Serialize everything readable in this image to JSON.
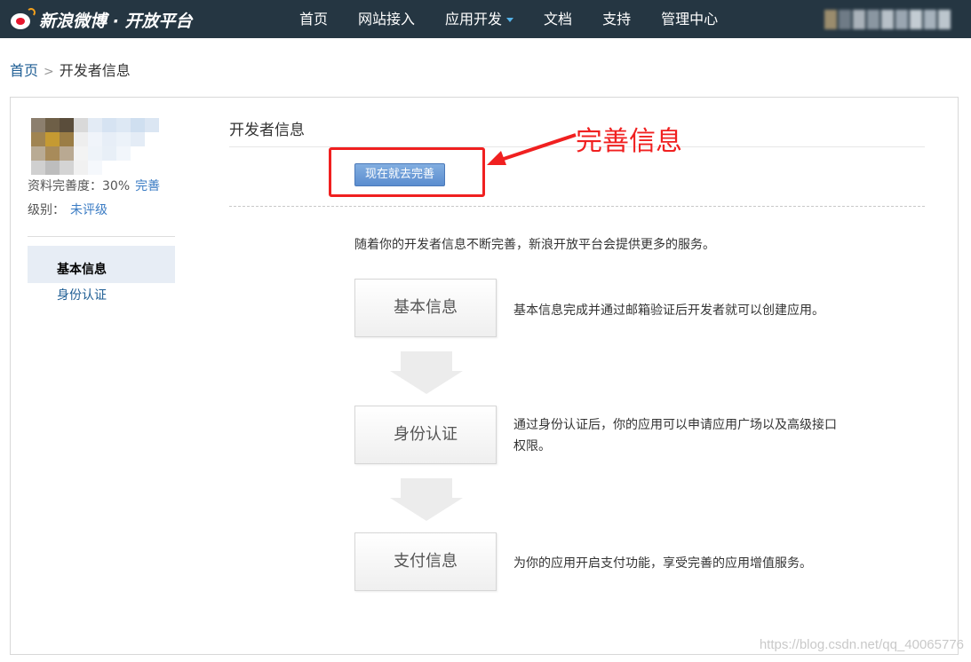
{
  "header": {
    "logo_text": "新浪微博 · 开放平台",
    "nav": [
      "首页",
      "网站接入",
      "应用开发",
      "文档",
      "支持",
      "管理中心"
    ],
    "accent_color": "#55b3e9",
    "bar_color": "#253642"
  },
  "breadcrumb": {
    "home": "首页",
    "separator": ">",
    "current": "开发者信息"
  },
  "sidebar": {
    "profile_completeness_label": "资料完善度：30%",
    "complete_link": "完善",
    "level_label": "级别：",
    "level_value": "未评级",
    "items": [
      {
        "label": "基本信息",
        "active": true
      },
      {
        "label": "身份认证",
        "active": false
      }
    ]
  },
  "content": {
    "title": "开发者信息",
    "complete_button": "现在就去完善",
    "annotation": "完善信息",
    "annotation_color": "#f02020",
    "intro": "随着你的开发者信息不断完善，新浪开放平台会提供更多的服务。",
    "steps": [
      {
        "label": "基本信息",
        "desc": "基本信息完成并通过邮箱验证后开发者就可以创建应用。"
      },
      {
        "label": "身份认证",
        "desc": "通过身份认证后，你的应用可以申请应用广场以及高级接口权限。"
      },
      {
        "label": "支付信息",
        "desc": "为你的应用开启支付功能，享受完善的应用增值服务。"
      }
    ]
  },
  "watermark": "https://blog.csdn.net/qq_40065776"
}
